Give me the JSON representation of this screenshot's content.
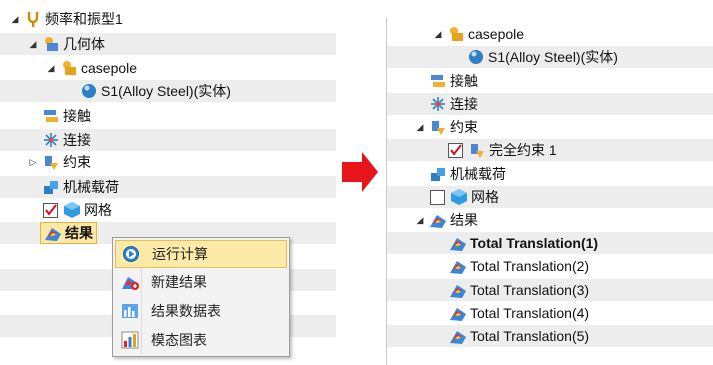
{
  "left_tree": {
    "root": "频率和振型1",
    "geometry": "几何体",
    "part": "casepole",
    "body": "S1(Alloy Steel)(实体)",
    "contact": "接触",
    "connection": "连接",
    "fixture": "约束",
    "load": "机械载荷",
    "mesh": "网格",
    "results": "结果"
  },
  "context_menu": {
    "items": [
      "运行计算",
      "新建结果",
      "结果数据表",
      "模态图表"
    ]
  },
  "right_tree": {
    "part": "casepole",
    "body": "S1(Alloy Steel)(实体)",
    "contact": "接触",
    "connection": "连接",
    "fixture": "约束",
    "fixture_child": "完全约束 1",
    "load": "机械载荷",
    "mesh": "网格",
    "results": "结果",
    "result_items": [
      "Total Translation(1)",
      "Total Translation(2)",
      "Total Translation(3)",
      "Total Translation(4)",
      "Total Translation(5)"
    ]
  },
  "colors": {
    "selection_bg": "#fce8a6",
    "arrow": "#e8141c",
    "row_alt": "#ededed"
  }
}
